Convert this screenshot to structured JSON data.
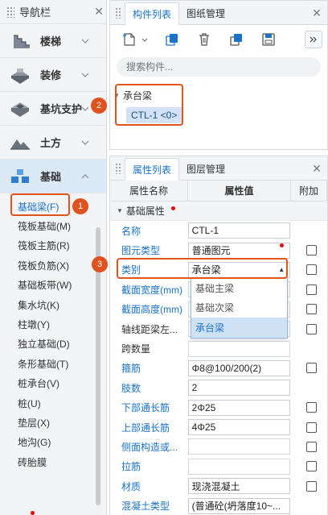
{
  "nav": {
    "title": "导航栏",
    "categories": [
      {
        "label": "楼梯",
        "icon": "stairs-icon"
      },
      {
        "label": "装修",
        "icon": "decoration-icon"
      },
      {
        "label": "基坑支护",
        "icon": "pit-support-icon"
      },
      {
        "label": "土方",
        "icon": "earthwork-icon"
      },
      {
        "label": "基础",
        "icon": "foundation-icon"
      }
    ],
    "sub_items": [
      "基础梁(F)",
      "筏板基础(M)",
      "筏板主筋(R)",
      "筏板负筋(X)",
      "基础板带(W)",
      "集水坑(K)",
      "柱墩(Y)",
      "独立基础(D)",
      "条形基础(T)",
      "桩承台(V)",
      "桩(U)",
      "垫层(X)",
      "地沟(G)",
      "砖胎膜"
    ]
  },
  "component_panel": {
    "tabs": [
      "构件列表",
      "图纸管理"
    ],
    "search_placeholder": "搜索构件...",
    "tree_group": "承台梁",
    "tree_item": "CTL-1 <0>"
  },
  "property_panel": {
    "tabs": [
      "属性列表",
      "图层管理"
    ],
    "columns": [
      "属性名称",
      "属性值",
      "附加"
    ],
    "group": "基础属性",
    "rows": [
      {
        "name": "名称",
        "value": "CTL-1",
        "blue": true,
        "check": false
      },
      {
        "name": "图元类型",
        "value": "普通图元",
        "blue": true,
        "check": true
      },
      {
        "name": "类别",
        "value": "承台梁",
        "blue": true,
        "check": true
      },
      {
        "name": "截面宽度(mm)",
        "value": "",
        "blue": true,
        "check": true
      },
      {
        "name": "截面高度(mm)",
        "value": "",
        "blue": true,
        "check": true
      },
      {
        "name": "轴线距梁左...",
        "value": "",
        "blue": false,
        "check": true
      },
      {
        "name": "跨数量",
        "value": "",
        "blue": false,
        "check": false
      },
      {
        "name": "箍筋",
        "value": "Φ8@100/200(2)",
        "blue": true,
        "check": true
      },
      {
        "name": "肢数",
        "value": "2",
        "blue": true,
        "check": false
      },
      {
        "name": "下部通长筋",
        "value": "2Φ25",
        "blue": true,
        "check": true
      },
      {
        "name": "上部通长筋",
        "value": "4Φ25",
        "blue": true,
        "check": true
      },
      {
        "name": "侧面构造或...",
        "value": "",
        "blue": true,
        "check": true
      },
      {
        "name": "拉筋",
        "value": "",
        "blue": true,
        "check": true
      },
      {
        "name": "材质",
        "value": "现浇混凝土",
        "blue": true,
        "check": true
      },
      {
        "name": "混凝土类型",
        "value": "(普通砼(坍落度10~...",
        "blue": true,
        "check": false
      }
    ],
    "dropdown_options": [
      "基础主梁",
      "基础次梁",
      "承台梁"
    ]
  },
  "badges": [
    "1",
    "2",
    "3"
  ],
  "colors": {
    "accent": "#1a73c9",
    "highlight": "#e0531f",
    "selection": "#cfe1f5"
  }
}
